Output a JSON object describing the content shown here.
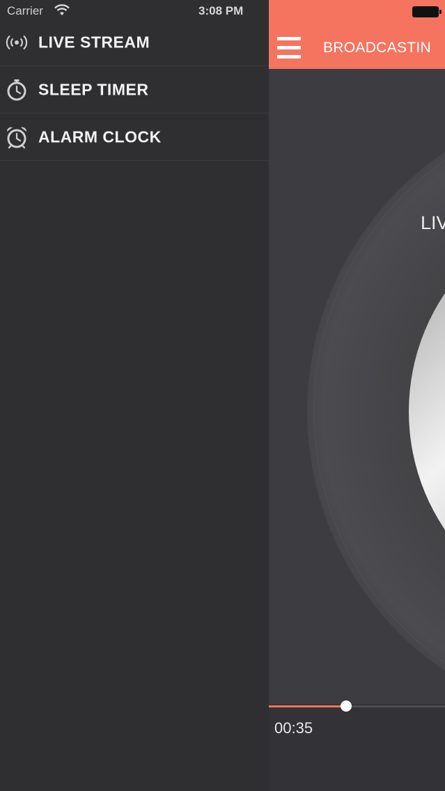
{
  "status_bar": {
    "carrier": "Carrier",
    "time": "3:08 PM"
  },
  "menu": {
    "items": [
      {
        "label": "LIVE STREAM",
        "icon": "broadcast-icon"
      },
      {
        "label": "SLEEP TIMER",
        "icon": "stopwatch-icon"
      },
      {
        "label": "ALARM CLOCK",
        "icon": "alarm-clock-icon"
      }
    ]
  },
  "nav": {
    "title": "BROADCASTIN"
  },
  "player": {
    "now_playing_label": "LIV",
    "elapsed": "00:35",
    "progress": 0.44
  },
  "colors": {
    "accent": "#f47460",
    "menu_bg": "#2f2e31",
    "text": "#f2f2f2"
  }
}
